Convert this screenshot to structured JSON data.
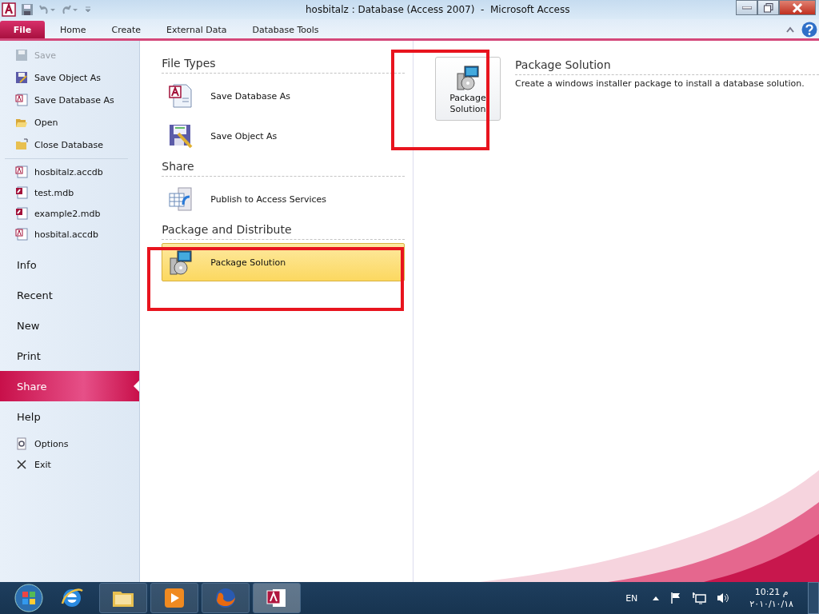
{
  "window": {
    "title": "hosbitalz : Database (Access 2007)  -  Microsoft Access"
  },
  "ribbon_tabs": [
    {
      "label": "File",
      "selected": true
    },
    {
      "label": "Home",
      "selected": false
    },
    {
      "label": "Create",
      "selected": false
    },
    {
      "label": "External Data",
      "selected": false
    },
    {
      "label": "Database Tools",
      "selected": false
    }
  ],
  "backstage_menu": {
    "commands": [
      {
        "label": "Save",
        "kind": "save",
        "disabled": true
      },
      {
        "label": "Save Object As",
        "kind": "save-as",
        "disabled": false
      },
      {
        "label": "Save Database As",
        "kind": "database",
        "disabled": false
      },
      {
        "label": "Open",
        "kind": "open",
        "disabled": false
      },
      {
        "label": "Close Database",
        "kind": "close",
        "disabled": false
      }
    ],
    "recent_files": [
      {
        "label": "hosbitalz.accdb",
        "kind": "accdb"
      },
      {
        "label": "test.mdb",
        "kind": "mdb"
      },
      {
        "label": "example2.mdb",
        "kind": "mdb"
      },
      {
        "label": "hosbital.accdb",
        "kind": "accdb"
      }
    ],
    "sections": [
      {
        "label": "Info",
        "selected": false
      },
      {
        "label": "Recent",
        "selected": false
      },
      {
        "label": "New",
        "selected": false
      },
      {
        "label": "Print",
        "selected": false
      },
      {
        "label": "Share",
        "selected": true
      },
      {
        "label": "Help",
        "selected": false
      }
    ],
    "footer": [
      {
        "label": "Options",
        "kind": "options"
      },
      {
        "label": "Exit",
        "kind": "exit"
      }
    ]
  },
  "share_options": [
    {
      "heading": "File Types",
      "items": [
        {
          "label": "Save Database As",
          "kind": "database",
          "selected": false
        },
        {
          "label": "Save Object As",
          "kind": "object",
          "selected": false
        }
      ]
    },
    {
      "heading": "Share",
      "items": [
        {
          "label": "Publish to Access Services",
          "kind": "publish",
          "selected": false
        }
      ]
    },
    {
      "heading": "Package and Distribute",
      "items": [
        {
          "label": "Package Solution",
          "kind": "package",
          "selected": true
        }
      ]
    }
  ],
  "detail": {
    "button": "Package Solution",
    "heading": "Package Solution",
    "description": "Create a windows installer package to install a database solution."
  },
  "taskbar": {
    "language": "EN",
    "time": "10:21 م",
    "date": "٢٠١٠/١٠/١٨"
  }
}
